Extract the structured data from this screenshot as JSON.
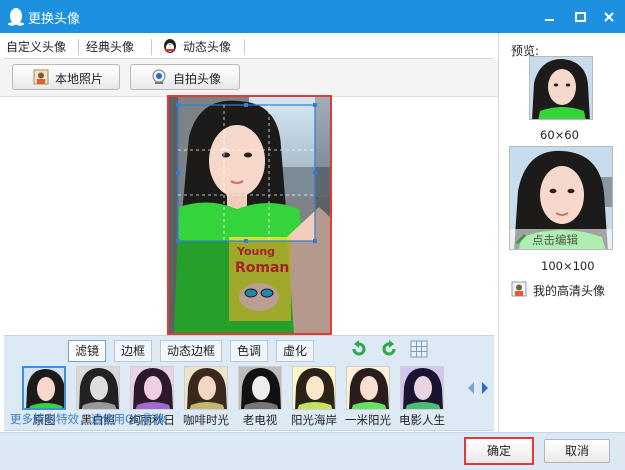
{
  "window": {
    "title": "更换头像",
    "min_label": "minimize",
    "max_label": "maximize",
    "close_label": "close",
    "titlebar_color": "#1d91e0"
  },
  "tabs": [
    {
      "label": "自定义头像"
    },
    {
      "label": "经典头像"
    },
    {
      "label": "动态头像",
      "icon": "penguin-icon"
    }
  ],
  "toolbar": {
    "local_photo": {
      "label": "本地照片",
      "icon": "photo-icon"
    },
    "selfie": {
      "label": "自拍头像",
      "icon": "camera-icon"
    }
  },
  "filters": {
    "tabs": [
      {
        "label": "滤镜",
        "active": true
      },
      {
        "label": "边框",
        "active": false
      },
      {
        "label": "动态边框",
        "active": false
      },
      {
        "label": "色调",
        "active": false
      },
      {
        "label": "虚化",
        "active": false
      }
    ],
    "thumbnails": [
      {
        "label": "原图",
        "selected": true
      },
      {
        "label": "黑白照",
        "selected": false
      },
      {
        "label": "绚丽秋日",
        "selected": false
      },
      {
        "label": "咖啡时光",
        "selected": false
      },
      {
        "label": "老电视",
        "selected": false
      },
      {
        "label": "阳光海岸",
        "selected": false
      },
      {
        "label": "一米阳光",
        "selected": false
      },
      {
        "label": "电影人生",
        "selected": false
      }
    ]
  },
  "preview": {
    "title": "预览:",
    "small_label": "60×60",
    "large_label": "100×100",
    "edit_label": "点击编辑",
    "hd_label": "我的高清头像"
  },
  "footer": {
    "hint": "更多精彩特效，请使用QQ影像",
    "ok": "确定",
    "cancel": "取消"
  },
  "colors": {
    "highlight_border": "#e53935",
    "link": "#3a7fc8"
  }
}
